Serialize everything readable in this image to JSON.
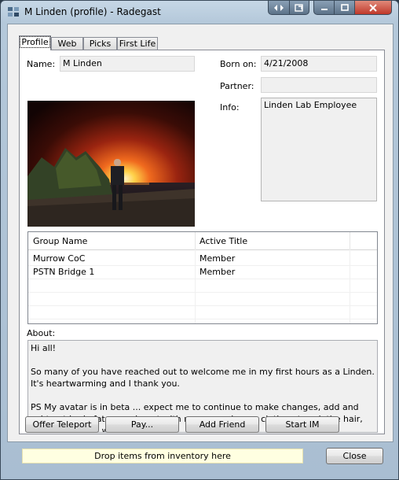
{
  "window": {
    "title": "M Linden (profile) - Radegast",
    "buttons": [
      "back-forward-icon",
      "detach-icon",
      "minimize-icon",
      "maximize-icon",
      "close-icon"
    ]
  },
  "tabs": [
    {
      "label": "Profile",
      "active": true
    },
    {
      "label": "Web",
      "active": false
    },
    {
      "label": "Picks",
      "active": false
    },
    {
      "label": "First Life",
      "active": false
    }
  ],
  "profile": {
    "name_label": "Name:",
    "name_value": "M Linden",
    "born_label": "Born on:",
    "born_value": "4/21/2008",
    "partner_label": "Partner:",
    "partner_value": "",
    "info_label": "Info:",
    "info_value": "Linden Lab Employee",
    "about_label": "About:",
    "about_paragraphs": [
      "Hi all!",
      "So many of you have reached out to welcome me in my first hours as a Linden.  It's heartwarming and I thank you.",
      "PS  My avatar is in beta ... expect me to continue to make changes, add and subtract body fat, experiment with my nose, change clothes, tweak the hair, etc.  Hey, I am a work-in-progress."
    ]
  },
  "groups": {
    "headers": [
      "Group Name",
      "Active Title"
    ],
    "rows": [
      [
        "Murrow CoC",
        "Member"
      ],
      [
        "PSTN Bridge 1",
        "Member"
      ]
    ]
  },
  "actions": {
    "offer_teleport": "Offer Teleport",
    "pay": "Pay...",
    "add_friend": "Add Friend",
    "start_im": "Start IM"
  },
  "footer": {
    "drop_hint": "Drop items from inventory here",
    "close": "Close"
  }
}
